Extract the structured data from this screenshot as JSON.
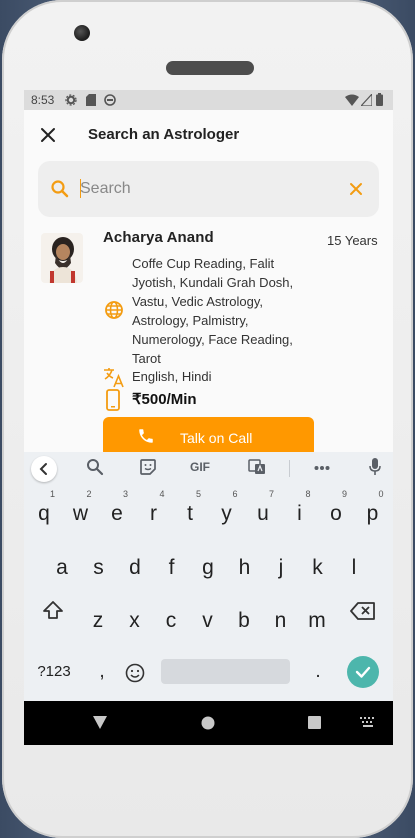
{
  "status_bar": {
    "time": "8:53"
  },
  "header": {
    "title": "Search an Astrologer"
  },
  "search": {
    "placeholder": "Search",
    "value": ""
  },
  "astrologer": {
    "name": "Acharya Anand",
    "experience": "15 Years",
    "skills": "Coffe Cup Reading, Falit Jyotish, Kundali Grah Dosh, Vastu, Vedic Astrology, Astrology, Palmistry, Numerology, Face Reading, Tarot",
    "languages": "English, Hindi",
    "price": "₹500/Min",
    "call_button": "Talk on Call"
  },
  "keyboard": {
    "toolbar": {
      "gif": "GIF"
    },
    "row1": [
      {
        "c": "q",
        "n": "1"
      },
      {
        "c": "w",
        "n": "2"
      },
      {
        "c": "e",
        "n": "3"
      },
      {
        "c": "r",
        "n": "4"
      },
      {
        "c": "t",
        "n": "5"
      },
      {
        "c": "y",
        "n": "6"
      },
      {
        "c": "u",
        "n": "7"
      },
      {
        "c": "i",
        "n": "8"
      },
      {
        "c": "o",
        "n": "9"
      },
      {
        "c": "p",
        "n": "0"
      }
    ],
    "row2": [
      "a",
      "s",
      "d",
      "f",
      "g",
      "h",
      "j",
      "k",
      "l"
    ],
    "row3": [
      "z",
      "x",
      "c",
      "v",
      "b",
      "n",
      "m"
    ],
    "symbols_key": "?123",
    "comma_key": ",",
    "period_key": "."
  },
  "colors": {
    "accent": "#ff9800",
    "enter": "#4db6ac"
  }
}
